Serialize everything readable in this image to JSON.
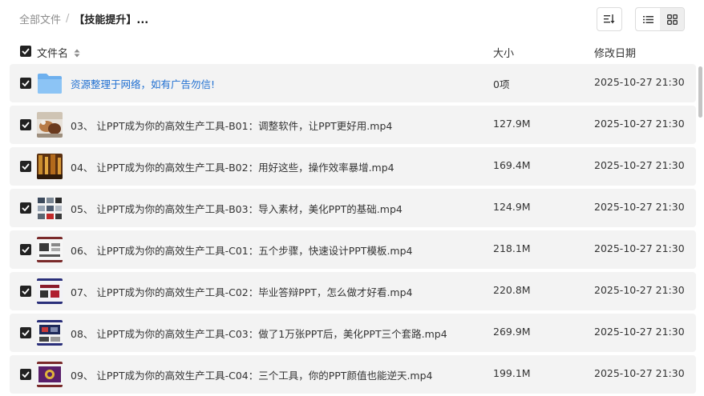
{
  "breadcrumb": {
    "root": "全部文件",
    "separator": "/",
    "current": "【技能提升】..."
  },
  "toolbar": {
    "sort_icon": "sort-icon",
    "list_view_icon": "list-view-icon",
    "grid_view_icon": "grid-view-icon",
    "active_view": "list"
  },
  "columns": {
    "name": "文件名",
    "size": "大小",
    "modified": "修改日期"
  },
  "colors": {
    "folder_link": "#1f6fd1",
    "row_bg": "#f3f3f3",
    "checkbox": "#222222"
  },
  "files": [
    {
      "type": "folder",
      "checked": true,
      "name": "资源整理于网络，如有广告勿信!",
      "size": "0项",
      "modified": "2025-10-27 21:30",
      "thumb": "folder-icon"
    },
    {
      "type": "video",
      "checked": true,
      "name": "03、 让PPT成为你的高效生产工具-B01：调整软件，让PPT更好用.mp4",
      "size": "127.9M",
      "modified": "2025-10-27 21:30",
      "thumb": "video-thumbnail"
    },
    {
      "type": "video",
      "checked": true,
      "name": "04、 让PPT成为你的高效生产工具-B02：用好这些，操作效率暴增.mp4",
      "size": "169.4M",
      "modified": "2025-10-27 21:30",
      "thumb": "video-thumbnail"
    },
    {
      "type": "video",
      "checked": true,
      "name": "05、 让PPT成为你的高效生产工具-B03：导入素材，美化PPT的基础.mp4",
      "size": "124.9M",
      "modified": "2025-10-27 21:30",
      "thumb": "video-thumbnail"
    },
    {
      "type": "video",
      "checked": true,
      "name": "06、 让PPT成为你的高效生产工具-C01：五个步骤，快速设计PPT模板.mp4",
      "size": "218.1M",
      "modified": "2025-10-27 21:30",
      "thumb": "video-thumbnail"
    },
    {
      "type": "video",
      "checked": true,
      "name": "07、 让PPT成为你的高效生产工具-C02：毕业答辩PPT，怎么做才好看.mp4",
      "size": "220.8M",
      "modified": "2025-10-27 21:30",
      "thumb": "video-thumbnail"
    },
    {
      "type": "video",
      "checked": true,
      "name": "08、 让PPT成为你的高效生产工具-C03：做了1万张PPT后，美化PPT三个套路.mp4",
      "size": "269.9M",
      "modified": "2025-10-27 21:30",
      "thumb": "video-thumbnail"
    },
    {
      "type": "video",
      "checked": true,
      "name": "09、 让PPT成为你的高效生产工具-C04：三个工具，你的PPT颜值也能逆天.mp4",
      "size": "199.1M",
      "modified": "2025-10-27 21:30",
      "thumb": "video-thumbnail"
    }
  ]
}
